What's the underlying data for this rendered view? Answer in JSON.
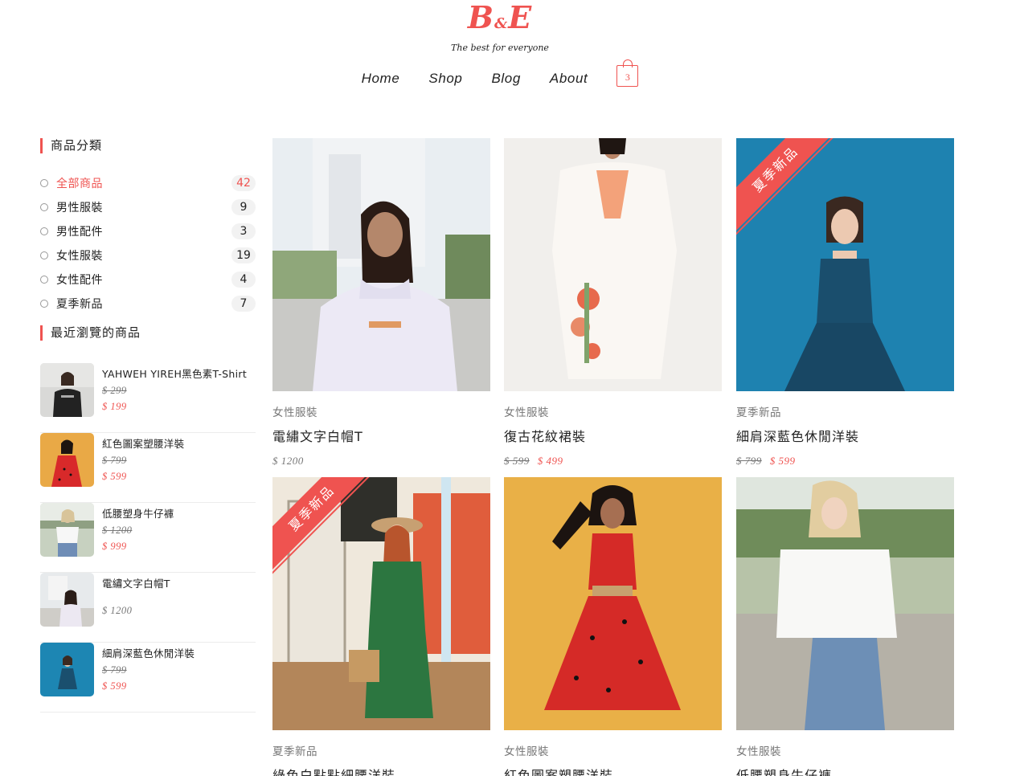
{
  "brand": {
    "logo_main": "B",
    "logo_amp": "&",
    "logo_end": "E",
    "tagline": "The best for everyone",
    "accent": "#ef5350"
  },
  "nav": {
    "items": [
      "Home",
      "Shop",
      "Blog",
      "About"
    ],
    "cart_count": "3",
    "cart_icon": "shopping-bag-icon"
  },
  "sidebar": {
    "categories_title": "商品分類",
    "categories": [
      {
        "name": "全部商品",
        "count": "42",
        "active": true
      },
      {
        "name": "男性服裝",
        "count": "9"
      },
      {
        "name": "男性配件",
        "count": "3"
      },
      {
        "name": "女性服裝",
        "count": "19"
      },
      {
        "name": "女性配件",
        "count": "4"
      },
      {
        "name": "夏季新品",
        "count": "7"
      }
    ],
    "recent_title": "最近瀏覽的商品",
    "recent": [
      {
        "name": "YAHWEH YIREH黑色素T-Shirt",
        "old": "$ 299",
        "new": "$ 199"
      },
      {
        "name": "紅色圖案塑腰洋裝",
        "old": "$ 799",
        "new": "$ 599"
      },
      {
        "name": "低腰塑身牛仔褲",
        "old": "$ 1200",
        "new": "$ 999"
      },
      {
        "name": "電繡文字白帽T",
        "price": "$ 1200"
      },
      {
        "name": "細肩深藍色休閒洋裝",
        "old": "$ 799",
        "new": "$ 599"
      }
    ]
  },
  "products": [
    {
      "category": "女性服裝",
      "name": "電繡文字白帽T",
      "price": "$ 1200"
    },
    {
      "category": "女性服裝",
      "name": "復古花紋裙裝",
      "old": "$ 599",
      "new": "$ 499"
    },
    {
      "category": "夏季新品",
      "name": "細肩深藍色休閒洋裝",
      "old": "$ 799",
      "new": "$ 599",
      "ribbon": "夏季新品"
    },
    {
      "category": "夏季新品",
      "name": "綠色白點點細腰洋裝",
      "ribbon": "夏季新品"
    },
    {
      "category": "女性服裝",
      "name": "紅色圖案塑腰洋裝"
    },
    {
      "category": "女性服裝",
      "name": "低腰塑身牛仔褲"
    }
  ]
}
